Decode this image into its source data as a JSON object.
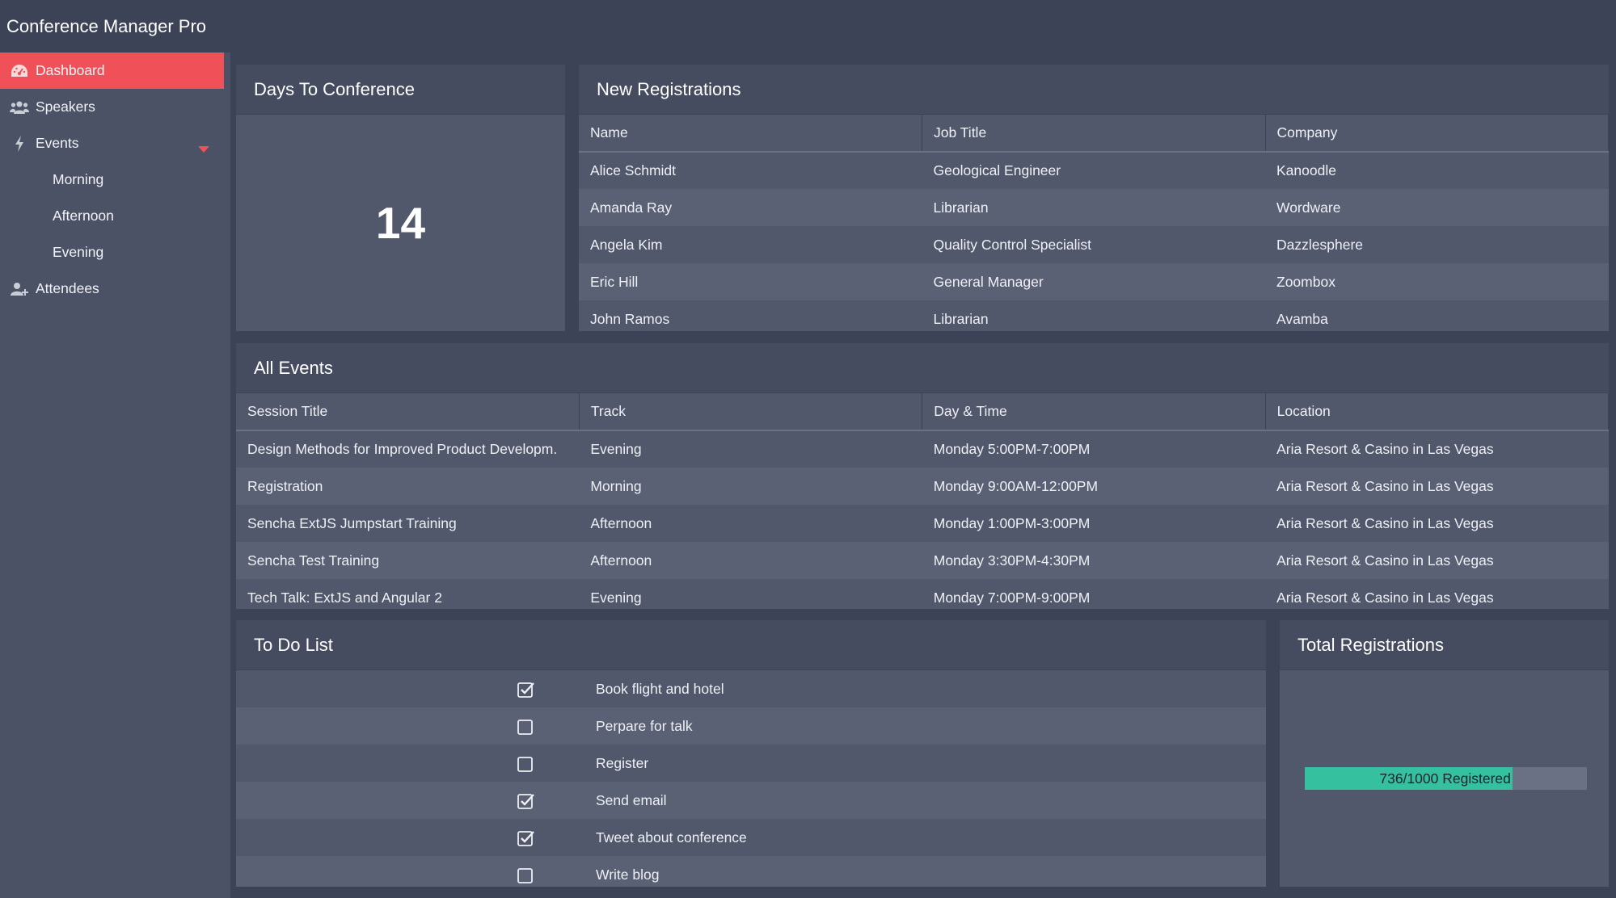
{
  "app": {
    "title": "Conference Manager Pro"
  },
  "colors": {
    "accent": "#f05158",
    "progress": "#35c0a0"
  },
  "sidebar": {
    "items": [
      {
        "label": "Dashboard",
        "icon": "dashboard-icon",
        "active": true
      },
      {
        "label": "Speakers",
        "icon": "users-icon"
      },
      {
        "label": "Events",
        "icon": "bolt-icon",
        "expanded": true
      },
      {
        "label": "Morning"
      },
      {
        "label": "Afternoon"
      },
      {
        "label": "Evening"
      },
      {
        "label": "Attendees",
        "icon": "user-plus-icon"
      }
    ]
  },
  "days_panel": {
    "title": "Days To Conference",
    "value": "14"
  },
  "registrations": {
    "title": "New Registrations",
    "columns": [
      "Name",
      "Job Title",
      "Company"
    ],
    "rows": [
      [
        "Alice Schmidt",
        "Geological Engineer",
        "Kanoodle"
      ],
      [
        "Amanda Ray",
        "Librarian",
        "Wordware"
      ],
      [
        "Angela Kim",
        "Quality Control Specialist",
        "Dazzlesphere"
      ],
      [
        "Eric Hill",
        "General Manager",
        "Zoombox"
      ],
      [
        "John Ramos",
        "Librarian",
        "Avamba"
      ]
    ]
  },
  "events": {
    "title": "All Events",
    "columns": [
      "Session Title",
      "Track",
      "Day & Time",
      "Location"
    ],
    "rows": [
      [
        "Design Methods for Improved Product Developm.",
        "Evening",
        "Monday 5:00PM-7:00PM",
        "Aria Resort & Casino in Las Vegas"
      ],
      [
        "Registration",
        "Morning",
        "Monday 9:00AM-12:00PM",
        "Aria Resort & Casino in Las Vegas"
      ],
      [
        "Sencha ExtJS Jumpstart Training",
        "Afternoon",
        "Monday 1:00PM-3:00PM",
        "Aria Resort & Casino in Las Vegas"
      ],
      [
        "Sencha Test Training",
        "Afternoon",
        "Monday 3:30PM-4:30PM",
        "Aria Resort & Casino in Las Vegas"
      ],
      [
        "Tech Talk: ExtJS and Angular 2",
        "Evening",
        "Monday 7:00PM-9:00PM",
        "Aria Resort & Casino in Las Vegas"
      ]
    ]
  },
  "todo": {
    "title": "To Do List",
    "items": [
      {
        "label": "Book flight and hotel",
        "checked": true
      },
      {
        "label": "Perpare for talk",
        "checked": false
      },
      {
        "label": "Register",
        "checked": false
      },
      {
        "label": "Send email",
        "checked": true
      },
      {
        "label": "Tweet about conference",
        "checked": true
      },
      {
        "label": "Write blog",
        "checked": false
      }
    ]
  },
  "total_registrations": {
    "title": "Total Registrations",
    "registered": 736,
    "capacity": 1000,
    "label": "736/1000 Registered"
  }
}
